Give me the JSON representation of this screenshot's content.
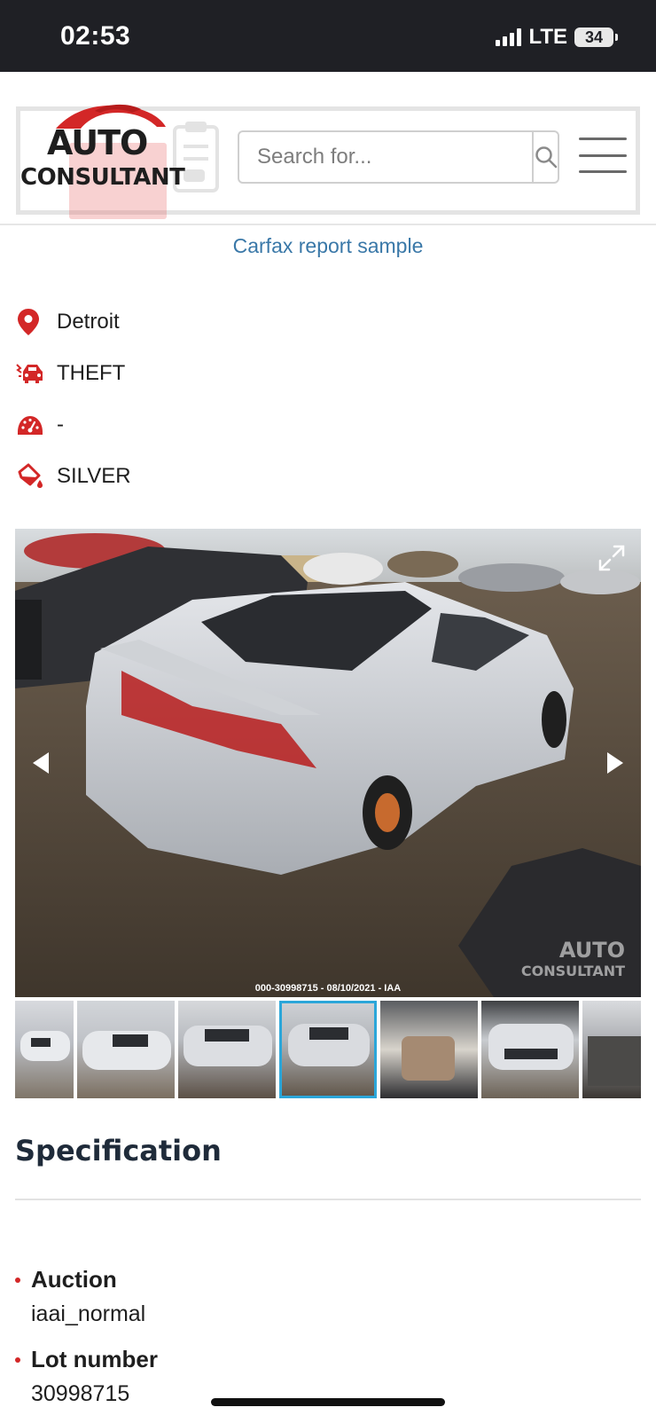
{
  "status_bar": {
    "time": "02:53",
    "network": "LTE",
    "battery": "34"
  },
  "header": {
    "logo_line1": "AUTO",
    "logo_line2": "CONSULTANT",
    "search_placeholder": "Search for..."
  },
  "carfax_link": "Carfax report sample",
  "vehicle_info": [
    {
      "icon": "location-pin-icon",
      "text": "Detroit"
    },
    {
      "icon": "car-damage-icon",
      "text": "THEFT"
    },
    {
      "icon": "speedometer-icon",
      "text": "-"
    },
    {
      "icon": "paint-bucket-icon",
      "text": "SILVER"
    }
  ],
  "gallery": {
    "main_caption": "000-30998715 - 08/10/2021 - IAA",
    "watermark_line1": "AUTO",
    "watermark_line2": "CONSULTANT",
    "thumbnail_count": 7,
    "active_thumbnail": 4
  },
  "specification": {
    "title": "Specification",
    "items": [
      {
        "label": "Auction",
        "value": "iaai_normal"
      },
      {
        "label": "Lot number",
        "value": "30998715"
      }
    ]
  },
  "colors": {
    "accent_red": "#d32727",
    "link_blue": "#3a78a8",
    "active_thumb_border": "#2ba6d9",
    "heading": "#1f2b3a"
  }
}
